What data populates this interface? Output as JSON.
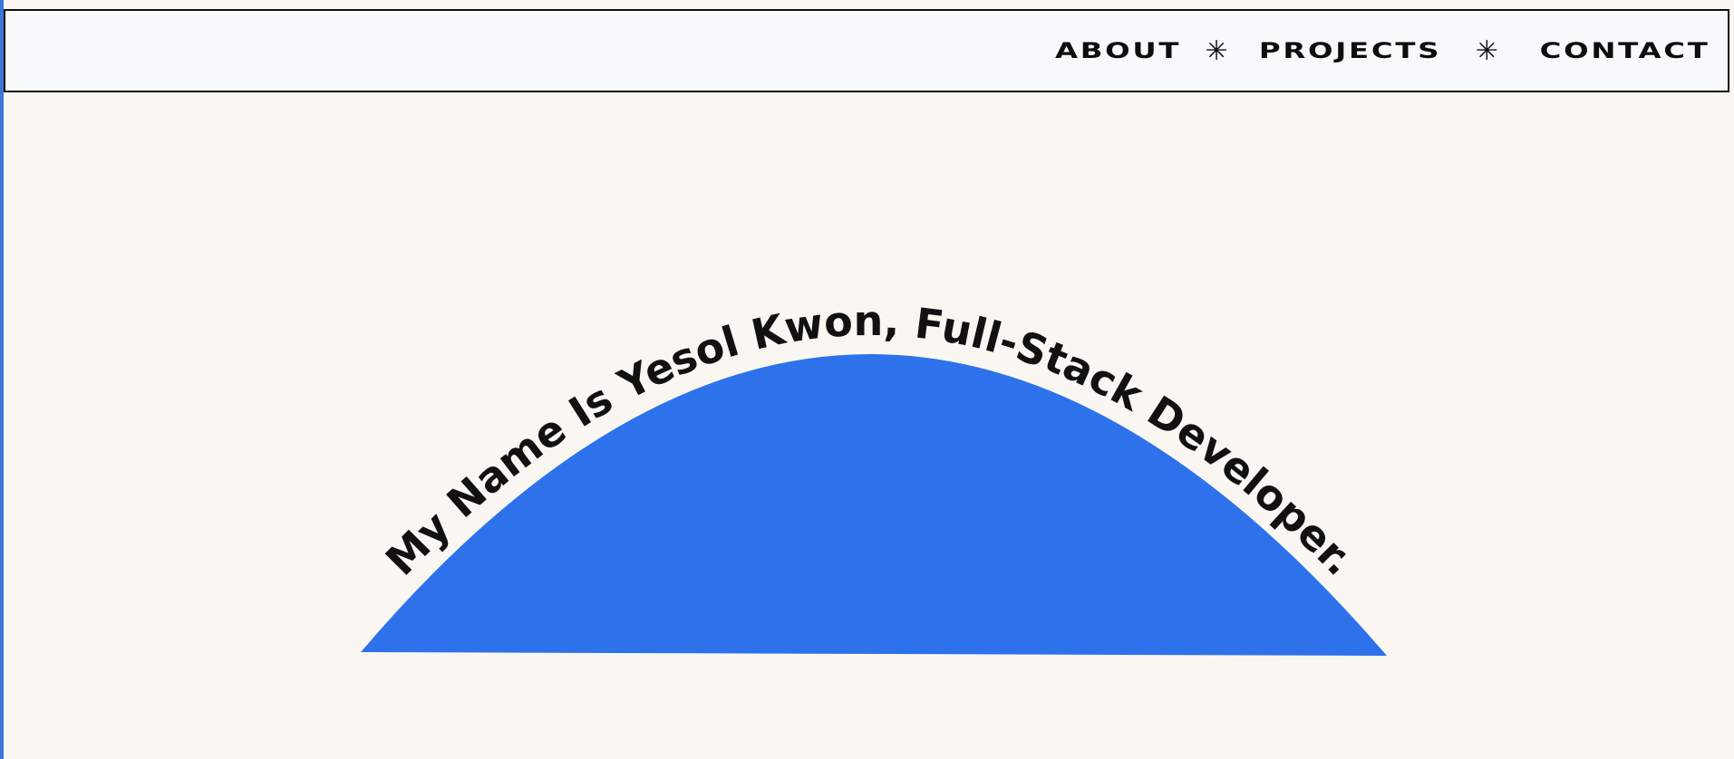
{
  "nav": {
    "about_label": "ABOUT",
    "projects_label": "PROJECTS",
    "contact_label": "CONTACT",
    "separator_glyph": "✳"
  },
  "hero": {
    "curved_text": "My Name Is Yesol Kwon, Full-Stack Developer.",
    "dome_color": "#2d72eb",
    "background_color": "#faf7f2"
  },
  "icons": [
    "asterisk-separator-icon"
  ]
}
